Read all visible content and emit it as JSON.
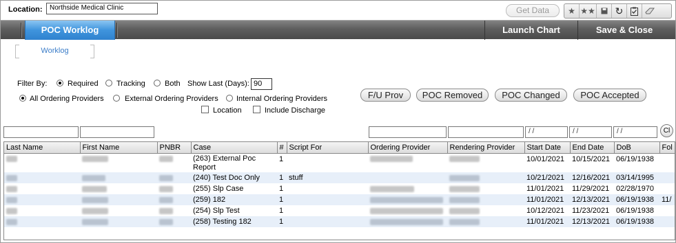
{
  "location": {
    "label": "Location:",
    "value": "Northside Medical Clinic"
  },
  "toolbar": {
    "get_data": "Get Data",
    "icons": [
      "star-icon",
      "double-star-icon",
      "save-icon",
      "refresh-icon",
      "clipboard-check-icon",
      "eraser-icon"
    ]
  },
  "nav": {
    "active_tab": "POC Worklog",
    "launch_chart": "Launch Chart",
    "save_close": "Save & Close"
  },
  "subtab": "Worklog",
  "filters": {
    "filter_by_label": "Filter By:",
    "required": "Required",
    "tracking": "Tracking",
    "both": "Both",
    "show_last_label": "Show Last (Days):",
    "show_last_value": "90",
    "all_providers": "All Ordering Providers",
    "external_providers": "External Ordering Providers",
    "internal_providers": "Internal Ordering Providers",
    "location": "Location",
    "include_discharge": "Include Discharge",
    "selected": "Required",
    "provider_selected": "All Ordering Providers"
  },
  "actions": {
    "fu_prov": "F/U Prov",
    "poc_removed": "POC Removed",
    "poc_changed": "POC Changed",
    "poc_accepted": "POC Accepted"
  },
  "date_placeholder": " / /",
  "clear_label": "Cl",
  "table": {
    "headers": [
      "Last Name",
      "First Name",
      "PNBR",
      "Case",
      "#",
      "Script For",
      "Ordering Provider",
      "Rendering Provider",
      "Start Date",
      "End Date",
      "DoB",
      "Fol"
    ],
    "rows": [
      {
        "case": "(263) External Poc Report",
        "num": "1",
        "script_for": "",
        "start": "10/01/2021",
        "end": "10/15/2021",
        "dob": "06/19/1938",
        "fol": ""
      },
      {
        "case": "(240) Test Doc Only",
        "num": "1",
        "script_for": "stuff",
        "start": "10/21/2021",
        "end": "12/16/2021",
        "dob": "03/14/1995",
        "fol": ""
      },
      {
        "case": "(255) Slp Case",
        "num": "1",
        "script_for": "",
        "start": "11/01/2021",
        "end": "11/29/2021",
        "dob": "02/28/1970",
        "fol": ""
      },
      {
        "case": "(259) 182",
        "num": "1",
        "script_for": "",
        "start": "11/01/2021",
        "end": "12/13/2021",
        "dob": "06/19/1938",
        "fol": "11/"
      },
      {
        "case": "(254) Slp Test",
        "num": "1",
        "script_for": "",
        "start": "10/12/2021",
        "end": "11/23/2021",
        "dob": "06/19/1938",
        "fol": ""
      },
      {
        "case": "(258) Testing 182",
        "num": "1",
        "script_for": "",
        "start": "11/01/2021",
        "end": "12/13/2021",
        "dob": "06/19/1938",
        "fol": ""
      }
    ]
  }
}
